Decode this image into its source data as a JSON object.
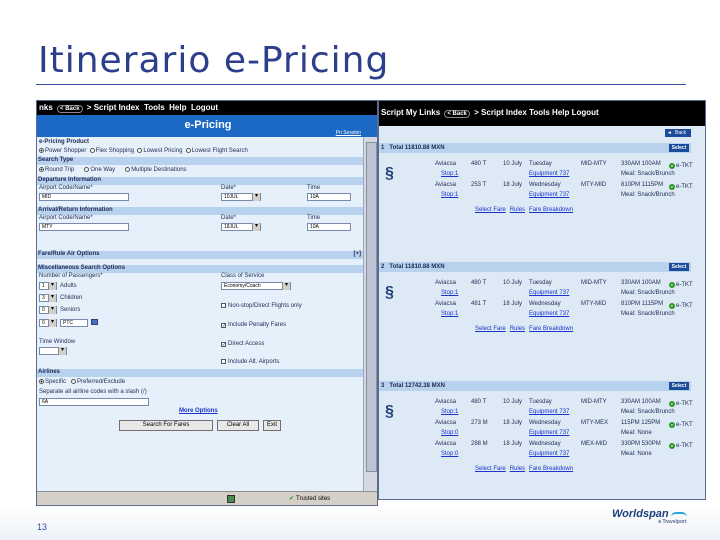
{
  "slide": {
    "title": "Itinerario e-Pricing",
    "number": "13",
    "logo": "Worldspan",
    "logo_sub": "a Travelport"
  },
  "left_nav": {
    "items": [
      "nks",
      "Back",
      "Script Index",
      "Tools",
      "Help",
      "Logout"
    ]
  },
  "right_nav": {
    "items": [
      "Script",
      "My Links",
      "Back",
      "Script Index",
      "Tools",
      "Help",
      "Logout"
    ]
  },
  "eform": {
    "header": "e-Pricing",
    "back_search": "Pri Session",
    "product_label": "e-Pricing Product",
    "products": [
      "Power Shopper",
      "Flex Shopping",
      "Lowest Pricing",
      "Lowest Flight Search"
    ],
    "search_type_label": "Search Type",
    "search_types": [
      "Round Trip",
      "One Way",
      "Multiple Destinations"
    ],
    "departure_label": "Departure Information",
    "origin_label": "Airport Code/Name*",
    "origin_value": "MID",
    "depart_date_label": "Date*",
    "depart_date_value": "10JUL",
    "depart_time_label": "Time",
    "depart_time_value": "10A",
    "arrival_label": "Arrival/Return Information",
    "dest_label": "Airport Code/Name*",
    "dest_value": "MTY",
    "return_date_label": "Date*",
    "return_date_value": "18JUL",
    "return_time_label": "Time",
    "return_time_value": "10A",
    "fare_rule_label": "Fare/Rule Air Options",
    "fare_rule_toggle": "[+]",
    "misc_label": "Miscellaneous Search Options",
    "pax_count_label": "Number of Passengers*",
    "pax": [
      {
        "count": "1",
        "type": "Adults"
      },
      {
        "count": "3",
        "type": "Children"
      },
      {
        "count": "0",
        "type": "Seniors"
      },
      {
        "count": "0",
        "type": "PTC"
      }
    ],
    "class_label": "Class of Service",
    "class_value": "Economy/Coach",
    "options": [
      {
        "label": "Non-stop/Direct Flights only",
        "checked": false
      },
      {
        "label": "Include Penalty Fares",
        "checked": true
      },
      {
        "label": "Direct Access",
        "checked": true
      },
      {
        "label": "Include Alt. Airports",
        "checked": false
      }
    ],
    "time_window_label": "Time Window",
    "airlines_label": "Airlines",
    "airline_modes": [
      "Specific",
      "Preferred/Exclude"
    ],
    "airline_codes_label": "Separate all airline codes with a slash (/)",
    "airline_codes_value": "6A",
    "more_options": "More Options",
    "buttons": [
      "Search For Fares",
      "Clear All",
      "Exit"
    ],
    "status_trusted": "Trusted sites"
  },
  "results": {
    "back_label": "Back",
    "options": [
      {
        "number": "1",
        "total": "Total 11810.88 MXN",
        "select": "Select",
        "segments": [
          {
            "airline": "Aviacsa",
            "flight": "480 T",
            "date": "10 July",
            "day": "Tuesday",
            "route": "MID-MTY",
            "times": "330AM  100AM",
            "equipment": "Stop:1",
            "equip_link": "Equipment 737",
            "meal": "Meal: Snack/Brunch",
            "etkt": "e-TKT"
          },
          {
            "airline": "Aviacsa",
            "flight": "253 T",
            "date": "18 July",
            "day": "Wednesday",
            "route": "MTY-MID",
            "times": "810PM  1115PM",
            "equipment": "Stop:1",
            "equip_link": "Equipment 737",
            "meal": "Meal: Snack/Brunch",
            "etkt": "e-TKT"
          }
        ],
        "links": [
          "Select Fare",
          "Rules",
          "Fare Breakdown"
        ]
      },
      {
        "number": "2",
        "total": "Total 11810.88 MXN",
        "select": "Select",
        "segments": [
          {
            "airline": "Aviacsa",
            "flight": "480 T",
            "date": "10 July",
            "day": "Tuesday",
            "route": "MID-MTY",
            "times": "330AM  100AM",
            "equipment": "Stop:1",
            "equip_link": "Equipment 737",
            "meal": "Meal: Snack/Brunch",
            "etkt": "e-TKT"
          },
          {
            "airline": "Aviacsa",
            "flight": "481 T",
            "date": "18 July",
            "day": "Wednesday",
            "route": "MTY-MID",
            "times": "810PM  1115PM",
            "equipment": "Stop:1",
            "equip_link": "Equipment 737",
            "meal": "Meal: Snack/Brunch",
            "etkt": "e-TKT"
          }
        ],
        "links": [
          "Select Fare",
          "Rules",
          "Fare Breakdown"
        ]
      },
      {
        "number": "3",
        "total": "Total 12742.38 MXN",
        "select": "Select",
        "segments": [
          {
            "airline": "Aviacsa",
            "flight": "480 T",
            "date": "10 July",
            "day": "Tuesday",
            "route": "MID-MTY",
            "times": "330AM  100AM",
            "equipment": "Stop:1",
            "equip_link": "Equipment 737",
            "meal": "Meal: Snack/Brunch",
            "etkt": "e-TKT"
          },
          {
            "airline": "Aviacsa",
            "flight": "273 M",
            "date": "18 July",
            "day": "Wednesday",
            "route": "MTY-MEX",
            "times": "115PM  125PM",
            "equipment": "Stop:0",
            "equip_link": "Equipment 737",
            "meal": "Meal: None",
            "etkt": "e-TKT"
          },
          {
            "airline": "Aviacsa",
            "flight": "288 M",
            "date": "18 July",
            "day": "Wednesday",
            "route": "MEX-MID",
            "times": "330PM  530PM",
            "equipment": "Stop:0",
            "equip_link": "Equipment 737",
            "meal": "Meal: None",
            "etkt": "e-TKT"
          }
        ],
        "links": [
          "Select Fare",
          "Rules",
          "Fare Breakdown"
        ]
      }
    ]
  },
  "colors": {
    "title": "#2c3e8c",
    "header_blue": "#1b69c5",
    "panel_bg": "#e6f0fa",
    "link": "#1a35c8"
  }
}
